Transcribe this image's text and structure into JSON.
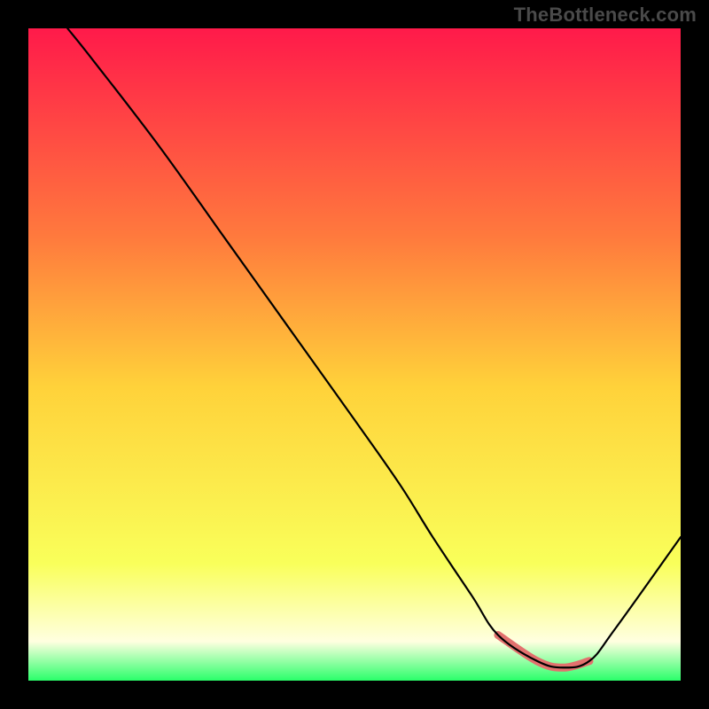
{
  "watermark": "TheBottleneck.com",
  "colors": {
    "gradient_top": "#ff1a4a",
    "gradient_upper_mid": "#ff7a3d",
    "gradient_mid": "#ffd23a",
    "gradient_lower_mid": "#f9ff5a",
    "gradient_near_bottom": "#ffffe0",
    "gradient_bottom": "#2aff6a",
    "curve": "#000000",
    "sweet_spot": "#e2716e",
    "background": "#000000"
  },
  "chart_data": {
    "type": "line",
    "title": "",
    "xlabel": "",
    "ylabel": "",
    "xlim": [
      0,
      100
    ],
    "ylim": [
      0,
      100
    ],
    "series": [
      {
        "name": "bottleneck-curve",
        "x": [
          6,
          10,
          20,
          30,
          40,
          50,
          57,
          62,
          68,
          72,
          78,
          82,
          86,
          90,
          100
        ],
        "values": [
          100,
          95,
          82,
          68,
          54,
          40,
          30,
          22,
          13,
          7,
          3,
          2,
          3,
          8,
          22
        ]
      }
    ],
    "sweet_spot_range_x": [
      71,
      86
    ],
    "annotations": []
  }
}
